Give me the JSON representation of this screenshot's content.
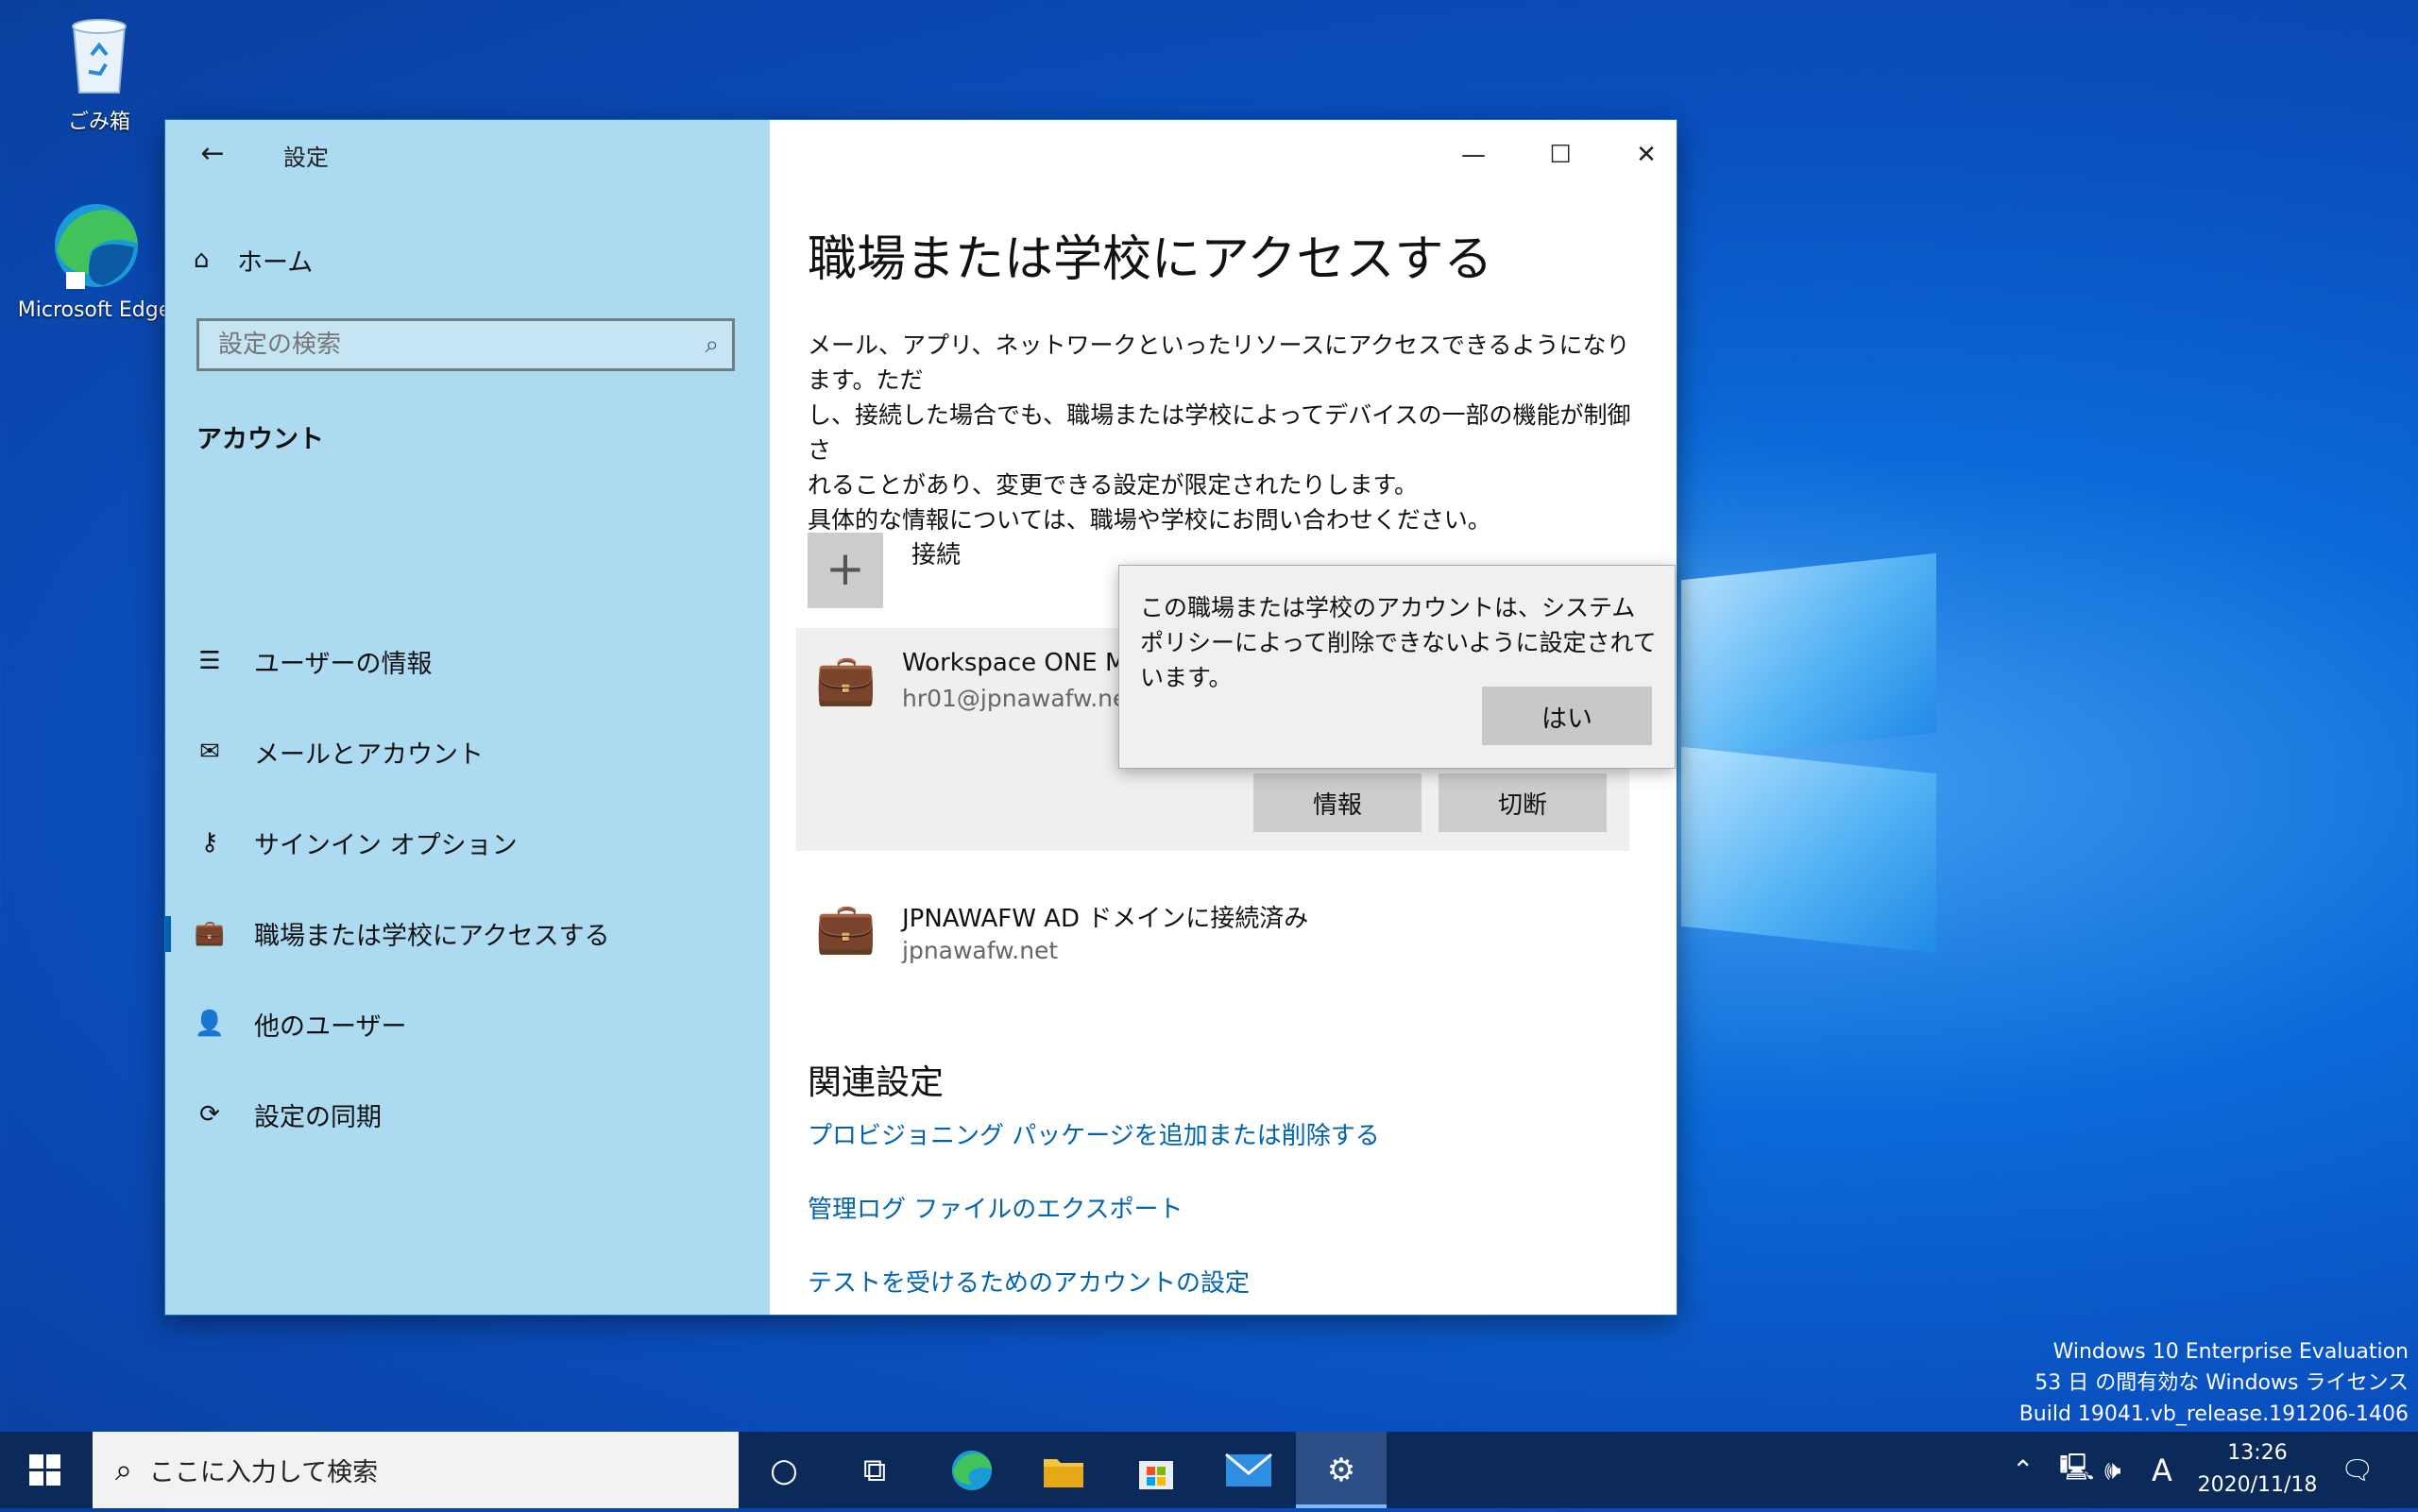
{
  "desktop": {
    "icons": [
      {
        "label": "ごみ箱"
      },
      {
        "label": "Microsoft Edge"
      }
    ],
    "watermark": [
      "Windows 10 Enterprise Evaluation",
      "53 日 の間有効な Windows ライセンス",
      "Build 19041.vb_release.191206-1406"
    ]
  },
  "window": {
    "title": "設定",
    "sidebar": {
      "home_label": "ホーム",
      "search_placeholder": "設定の検索",
      "section_title": "アカウント",
      "items": [
        {
          "label": "ユーザーの情報",
          "icon": "user-info-icon"
        },
        {
          "label": "メールとアカウント",
          "icon": "mail-icon"
        },
        {
          "label": "サインイン オプション",
          "icon": "key-icon"
        },
        {
          "label": "職場または学校にアクセスする",
          "icon": "briefcase-icon",
          "selected": true
        },
        {
          "label": "他のユーザー",
          "icon": "add-user-icon"
        },
        {
          "label": "設定の同期",
          "icon": "sync-icon"
        }
      ]
    },
    "main": {
      "title": "職場または学校にアクセスする",
      "description": [
        "メール、アプリ、ネットワークといったリソースにアクセスできるようになります。ただ",
        "し、接続した場合でも、職場または学校によってデバイスの一部の機能が制御さ",
        "れることがあり、変更できる設定が限定されたりします。",
        "具体的な情報については、職場や学校にお問い合わせください。"
      ],
      "connect_label": "接続",
      "account": {
        "name": "Workspace ONE M",
        "email": "hr01@jpnawafw.ne",
        "info_button": "情報",
        "disconnect_button": "切断"
      },
      "domain_account": {
        "name": "JPNAWAFW AD ドメインに接続済み",
        "domain": "jpnawafw.net"
      },
      "related_title": "関連設定",
      "links": [
        "プロビジョニング パッケージを追加または削除する",
        "管理ログ ファイルのエクスポート",
        "テストを受けるためのアカウントの設定"
      ]
    },
    "dialog": {
      "message": "この職場または学校のアカウントは、システム ポリシーによって削除できないように設定されています。",
      "ok_button": "はい"
    }
  },
  "taskbar": {
    "search_placeholder": "ここに入力して検索",
    "ime_indicator": "A",
    "time": "13:26",
    "date": "2020/11/18"
  }
}
